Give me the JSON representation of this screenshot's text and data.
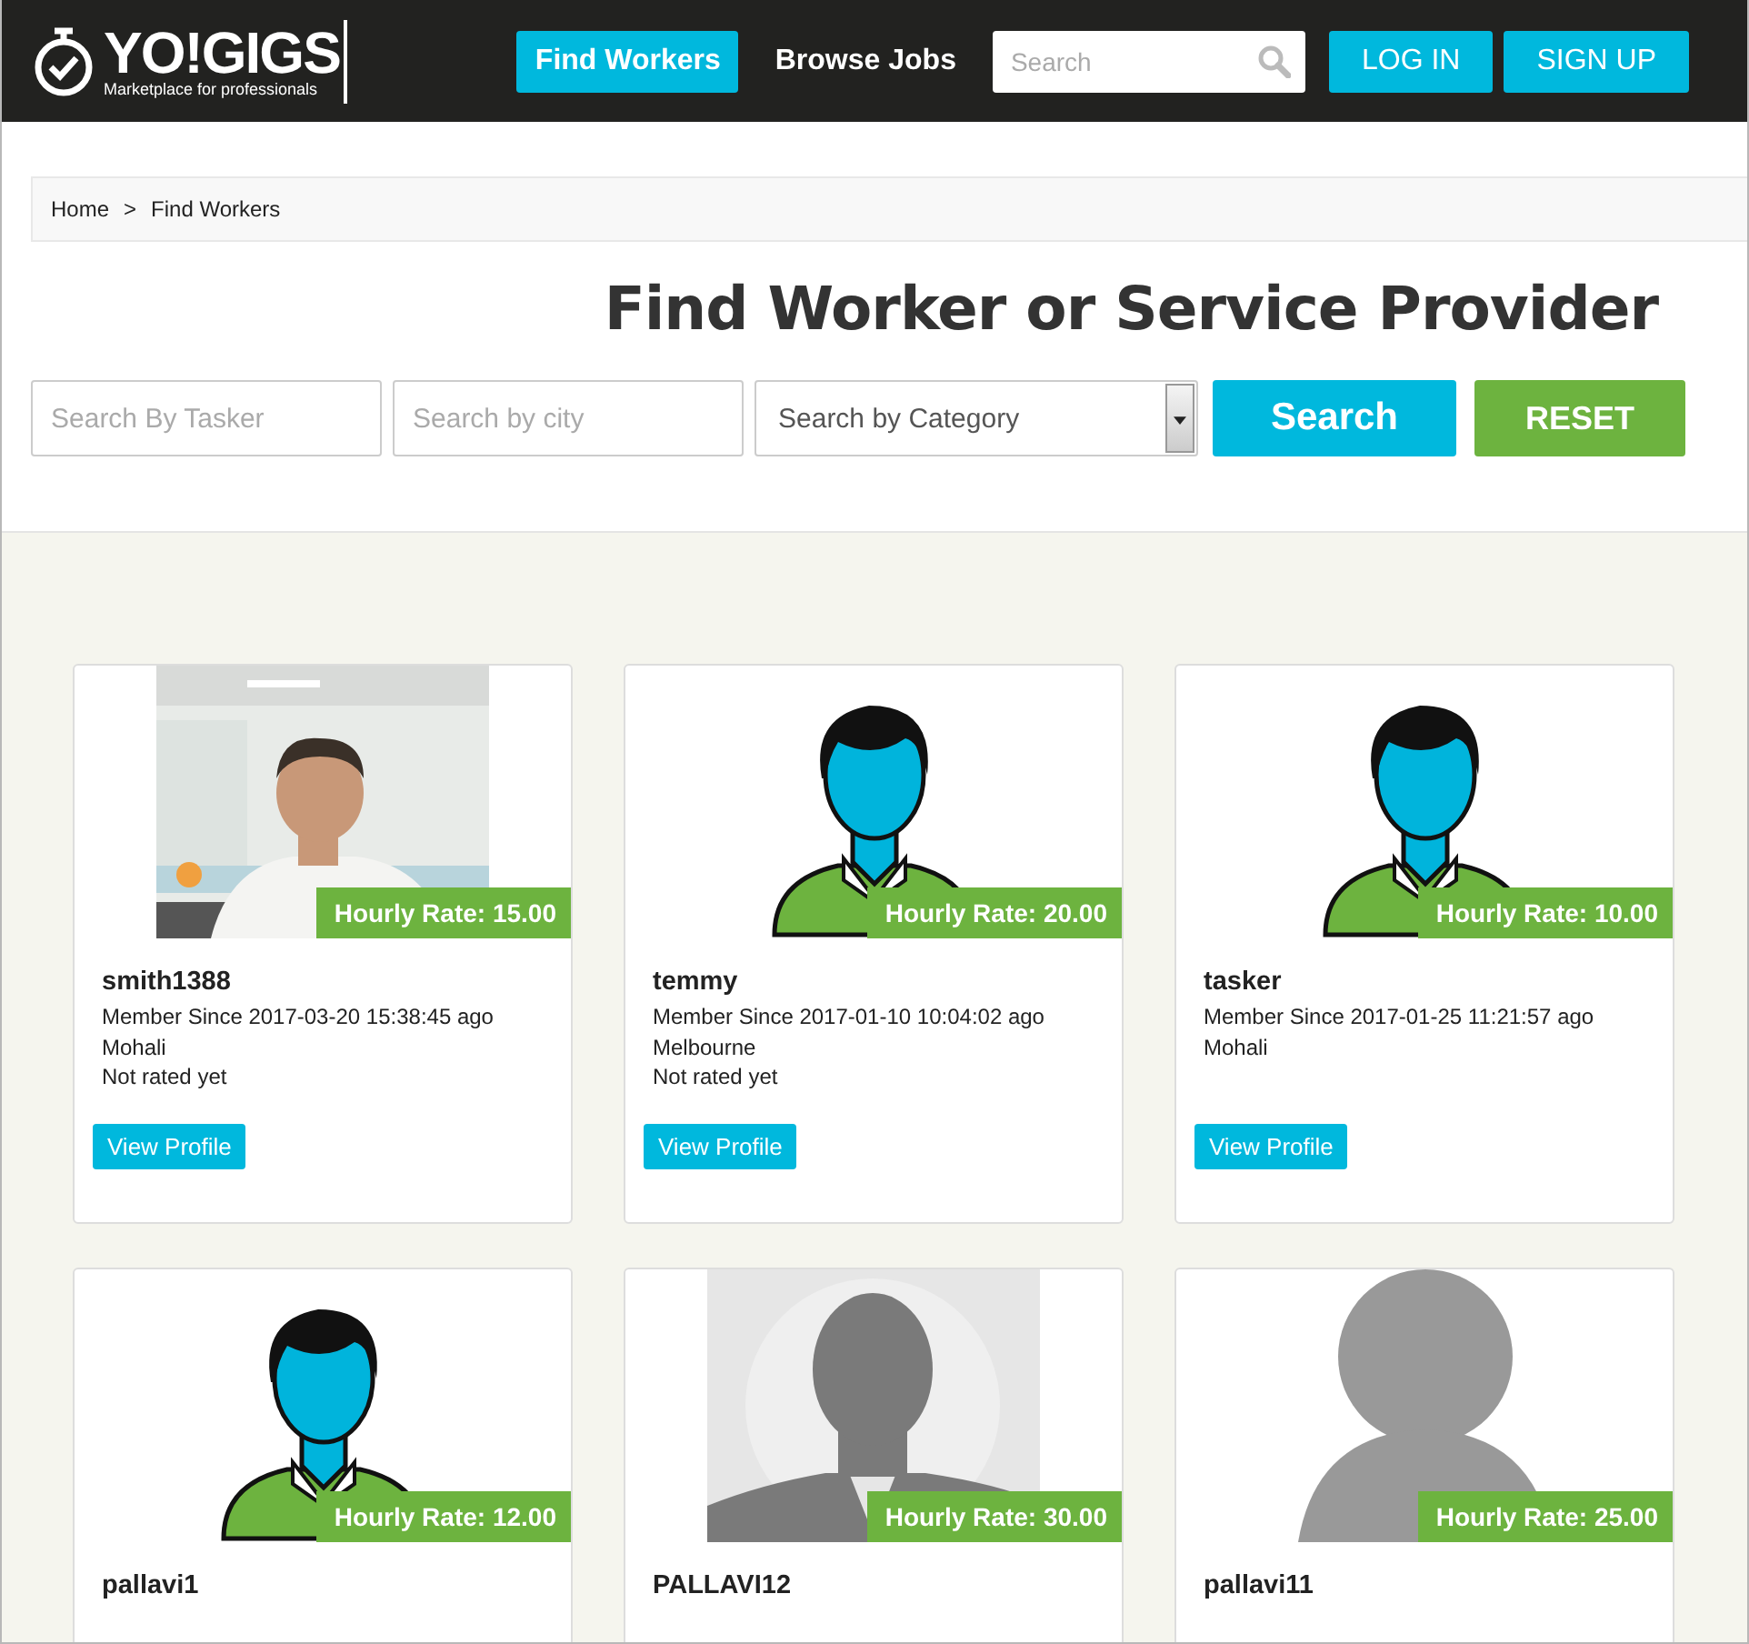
{
  "header": {
    "logo": {
      "name": "YO!GIGS",
      "tagline": "Marketplace for professionals"
    },
    "nav": [
      {
        "label": "Find Workers",
        "selected": true
      },
      {
        "label": "Browse Jobs",
        "selected": false
      }
    ],
    "search": {
      "placeholder": "Search"
    },
    "buttons": [
      "LOG IN",
      "SIGN UP"
    ]
  },
  "breadcrumb": [
    "Home",
    "Find Workers"
  ],
  "breadcrumb_separator": ">",
  "title": "Find Worker or Service Provider",
  "filters": {
    "tasker": {
      "placeholder": "Search By Tasker"
    },
    "city": {
      "placeholder": "Search by city"
    },
    "category": {
      "value": "Search by Category"
    },
    "search_button": "Search",
    "reset_button": "RESET"
  },
  "workers": [
    {
      "rate": "Hourly Rate: 15.00",
      "name": "smith1388",
      "member_since": "Member Since 2017-03-20 15:38:45 ago",
      "city": "Mohali",
      "rating": "Not rated yet",
      "button": "View Profile"
    },
    {
      "kind": "cartoon",
      "rate": "Hourly Rate: 20.00",
      "name": "temmy",
      "member_since": "Member Since 2017-01-10 10:04:02 ago",
      "city": "Melbourne",
      "rating": "Not rated yet",
      "button": "View Profile"
    },
    {
      "kind": "cartoon",
      "rate": "Hourly Rate: 10.00",
      "name": "tasker",
      "member_since": "Member Since 2017-01-25 11:21:57 ago",
      "city": "Mohali",
      "button": "View Profile"
    },
    {
      "kind": "cartoon",
      "rate": "Hourly Rate: 12.00",
      "name": "pallavi1"
    },
    {
      "kind": "grey-bust",
      "rate": "Hourly Rate: 30.00",
      "name": "PALLAVI12"
    },
    {
      "kind": "grey-circle",
      "rate": "Hourly Rate: 25.00",
      "name": "pallavi11"
    }
  ]
}
